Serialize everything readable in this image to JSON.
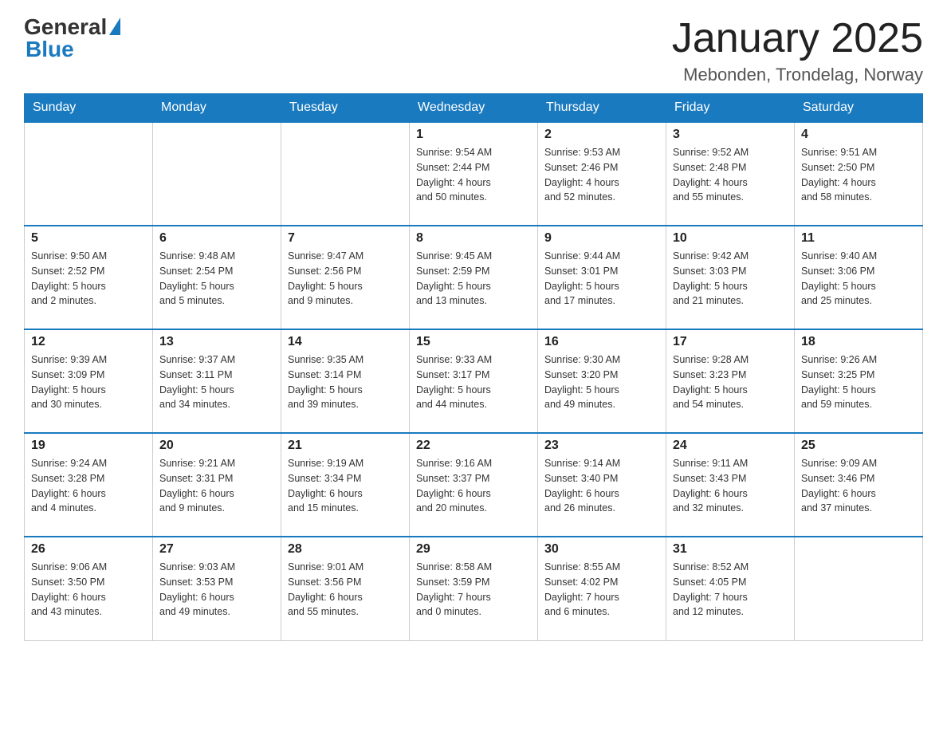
{
  "header": {
    "logo_general": "General",
    "logo_blue": "Blue",
    "month_title": "January 2025",
    "location": "Mebonden, Trondelag, Norway"
  },
  "weekdays": [
    "Sunday",
    "Monday",
    "Tuesday",
    "Wednesday",
    "Thursday",
    "Friday",
    "Saturday"
  ],
  "weeks": [
    [
      {
        "day": "",
        "info": ""
      },
      {
        "day": "",
        "info": ""
      },
      {
        "day": "",
        "info": ""
      },
      {
        "day": "1",
        "info": "Sunrise: 9:54 AM\nSunset: 2:44 PM\nDaylight: 4 hours\nand 50 minutes."
      },
      {
        "day": "2",
        "info": "Sunrise: 9:53 AM\nSunset: 2:46 PM\nDaylight: 4 hours\nand 52 minutes."
      },
      {
        "day": "3",
        "info": "Sunrise: 9:52 AM\nSunset: 2:48 PM\nDaylight: 4 hours\nand 55 minutes."
      },
      {
        "day": "4",
        "info": "Sunrise: 9:51 AM\nSunset: 2:50 PM\nDaylight: 4 hours\nand 58 minutes."
      }
    ],
    [
      {
        "day": "5",
        "info": "Sunrise: 9:50 AM\nSunset: 2:52 PM\nDaylight: 5 hours\nand 2 minutes."
      },
      {
        "day": "6",
        "info": "Sunrise: 9:48 AM\nSunset: 2:54 PM\nDaylight: 5 hours\nand 5 minutes."
      },
      {
        "day": "7",
        "info": "Sunrise: 9:47 AM\nSunset: 2:56 PM\nDaylight: 5 hours\nand 9 minutes."
      },
      {
        "day": "8",
        "info": "Sunrise: 9:45 AM\nSunset: 2:59 PM\nDaylight: 5 hours\nand 13 minutes."
      },
      {
        "day": "9",
        "info": "Sunrise: 9:44 AM\nSunset: 3:01 PM\nDaylight: 5 hours\nand 17 minutes."
      },
      {
        "day": "10",
        "info": "Sunrise: 9:42 AM\nSunset: 3:03 PM\nDaylight: 5 hours\nand 21 minutes."
      },
      {
        "day": "11",
        "info": "Sunrise: 9:40 AM\nSunset: 3:06 PM\nDaylight: 5 hours\nand 25 minutes."
      }
    ],
    [
      {
        "day": "12",
        "info": "Sunrise: 9:39 AM\nSunset: 3:09 PM\nDaylight: 5 hours\nand 30 minutes."
      },
      {
        "day": "13",
        "info": "Sunrise: 9:37 AM\nSunset: 3:11 PM\nDaylight: 5 hours\nand 34 minutes."
      },
      {
        "day": "14",
        "info": "Sunrise: 9:35 AM\nSunset: 3:14 PM\nDaylight: 5 hours\nand 39 minutes."
      },
      {
        "day": "15",
        "info": "Sunrise: 9:33 AM\nSunset: 3:17 PM\nDaylight: 5 hours\nand 44 minutes."
      },
      {
        "day": "16",
        "info": "Sunrise: 9:30 AM\nSunset: 3:20 PM\nDaylight: 5 hours\nand 49 minutes."
      },
      {
        "day": "17",
        "info": "Sunrise: 9:28 AM\nSunset: 3:23 PM\nDaylight: 5 hours\nand 54 minutes."
      },
      {
        "day": "18",
        "info": "Sunrise: 9:26 AM\nSunset: 3:25 PM\nDaylight: 5 hours\nand 59 minutes."
      }
    ],
    [
      {
        "day": "19",
        "info": "Sunrise: 9:24 AM\nSunset: 3:28 PM\nDaylight: 6 hours\nand 4 minutes."
      },
      {
        "day": "20",
        "info": "Sunrise: 9:21 AM\nSunset: 3:31 PM\nDaylight: 6 hours\nand 9 minutes."
      },
      {
        "day": "21",
        "info": "Sunrise: 9:19 AM\nSunset: 3:34 PM\nDaylight: 6 hours\nand 15 minutes."
      },
      {
        "day": "22",
        "info": "Sunrise: 9:16 AM\nSunset: 3:37 PM\nDaylight: 6 hours\nand 20 minutes."
      },
      {
        "day": "23",
        "info": "Sunrise: 9:14 AM\nSunset: 3:40 PM\nDaylight: 6 hours\nand 26 minutes."
      },
      {
        "day": "24",
        "info": "Sunrise: 9:11 AM\nSunset: 3:43 PM\nDaylight: 6 hours\nand 32 minutes."
      },
      {
        "day": "25",
        "info": "Sunrise: 9:09 AM\nSunset: 3:46 PM\nDaylight: 6 hours\nand 37 minutes."
      }
    ],
    [
      {
        "day": "26",
        "info": "Sunrise: 9:06 AM\nSunset: 3:50 PM\nDaylight: 6 hours\nand 43 minutes."
      },
      {
        "day": "27",
        "info": "Sunrise: 9:03 AM\nSunset: 3:53 PM\nDaylight: 6 hours\nand 49 minutes."
      },
      {
        "day": "28",
        "info": "Sunrise: 9:01 AM\nSunset: 3:56 PM\nDaylight: 6 hours\nand 55 minutes."
      },
      {
        "day": "29",
        "info": "Sunrise: 8:58 AM\nSunset: 3:59 PM\nDaylight: 7 hours\nand 0 minutes."
      },
      {
        "day": "30",
        "info": "Sunrise: 8:55 AM\nSunset: 4:02 PM\nDaylight: 7 hours\nand 6 minutes."
      },
      {
        "day": "31",
        "info": "Sunrise: 8:52 AM\nSunset: 4:05 PM\nDaylight: 7 hours\nand 12 minutes."
      },
      {
        "day": "",
        "info": ""
      }
    ]
  ]
}
